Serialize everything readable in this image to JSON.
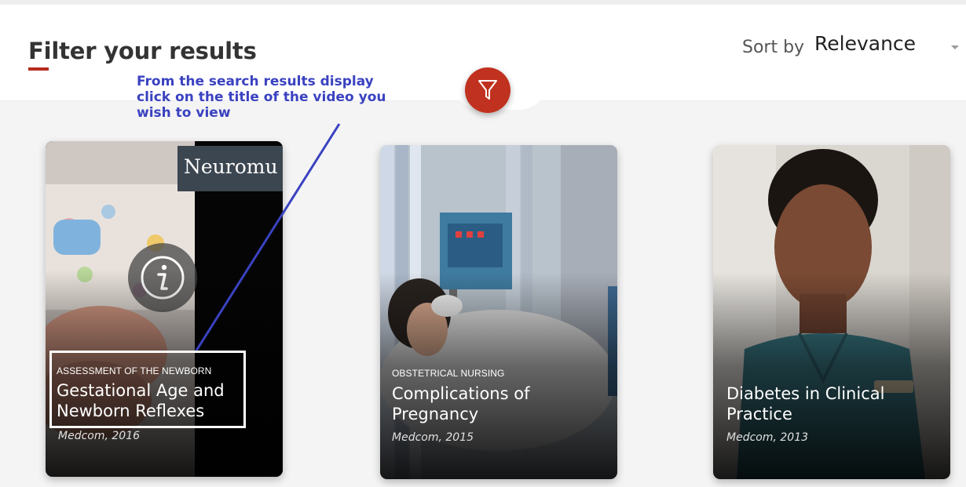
{
  "header": {
    "title": "Filter your results",
    "sort_label": "Sort by",
    "sort_value": "Relevance"
  },
  "filter_button": {
    "icon": "filter-funnel-icon"
  },
  "annotation": {
    "text": "From the search results display\nclick on the title of the video you\nwish to view"
  },
  "colors": {
    "accent": "#c0321f",
    "annotation": "#3a42c0"
  },
  "results": [
    {
      "category": "ASSESSMENT OF THE NEWBORN",
      "title": "Gestational Age and\nNewborn Reflexes",
      "meta": "Medcom, 2016",
      "overlay_text": "Neuromu"
    },
    {
      "category": "OBSTETRICAL NURSING",
      "title": "Complications of\nPregnancy",
      "meta": "Medcom, 2015"
    },
    {
      "category": "",
      "title": "Diabetes in Clinical\nPractice",
      "meta": "Medcom, 2013"
    }
  ]
}
